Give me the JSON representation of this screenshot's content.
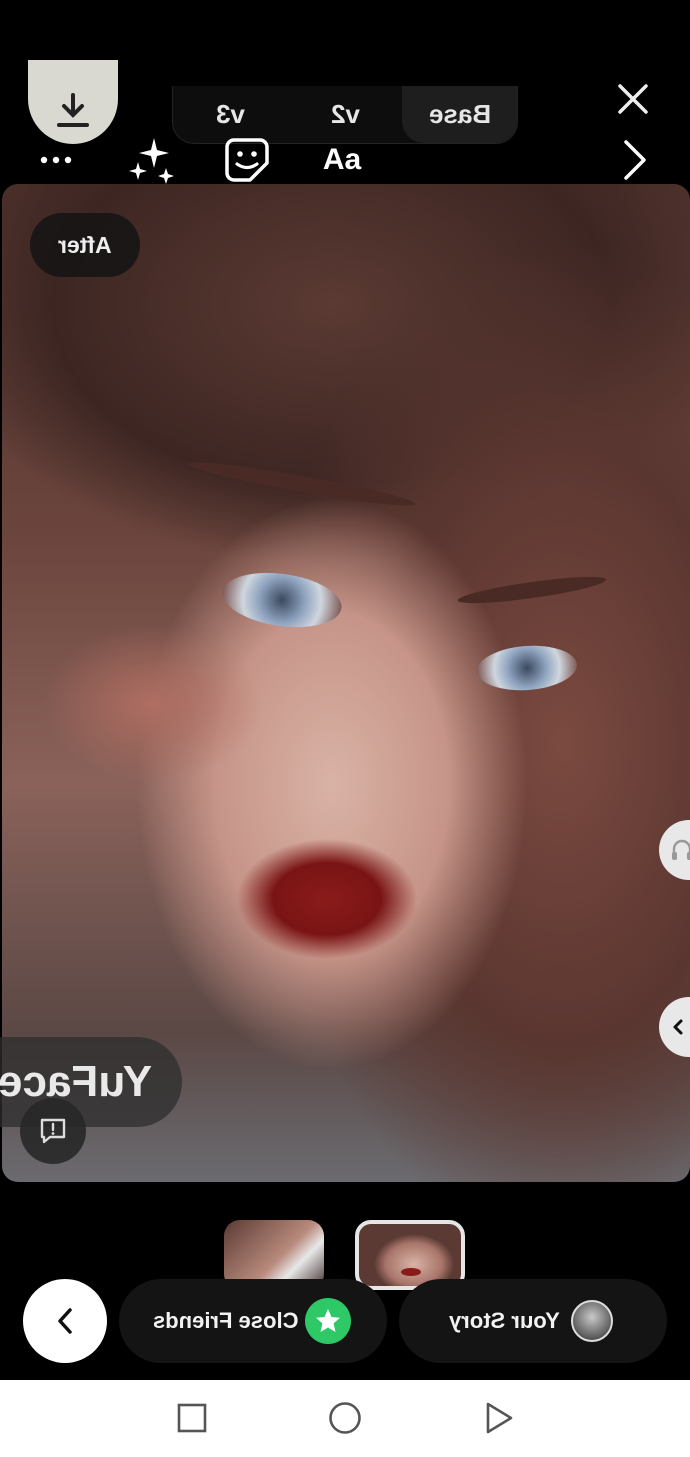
{
  "top_bar": {
    "version_tabs": [
      {
        "label": "Base",
        "active": true
      },
      {
        "label": "v2",
        "active": false
      },
      {
        "label": "v3",
        "active": false
      }
    ]
  },
  "toolbar": {
    "text_tool_label": "Aa"
  },
  "photo": {
    "after_label": "After",
    "watermark_text": "YuFace"
  },
  "thumbnails": [
    "story-thumbnail-1",
    "story-thumbnail-2"
  ],
  "share_bar": {
    "close_friends_label": "Close Friends",
    "your_story_label": "Your Story"
  },
  "colors": {
    "close_friends_green": "#2ec866",
    "background": "#000000",
    "navbar": "#ffffff"
  },
  "icons": {
    "download": "download-icon",
    "close": "close-icon",
    "more": "more-dots-icon",
    "effects": "sparkles-icon",
    "sticker": "sticker-icon",
    "next": "chevron-right-icon",
    "report": "report-icon",
    "audio": "headphones-icon",
    "back": "chevron-left-icon",
    "star": "star-icon",
    "avatar": "avatar"
  }
}
